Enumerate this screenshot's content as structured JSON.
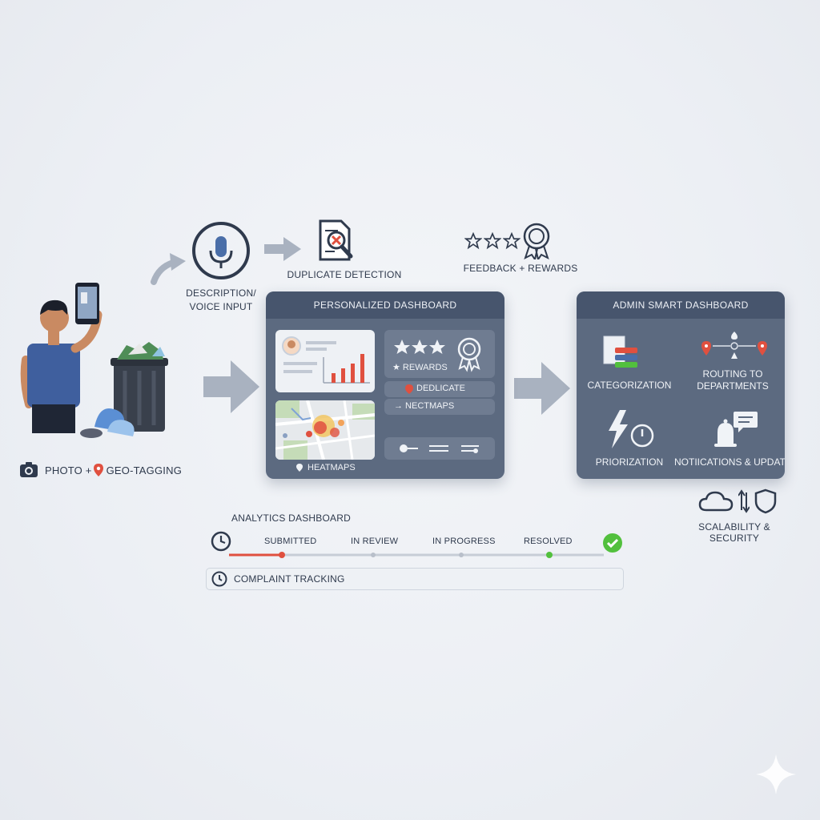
{
  "labels": {
    "description_voice": [
      "DESCRIPTION/",
      "VOICE INPUT"
    ],
    "duplicate_detection": "DUPLICATE DETECTION",
    "feedback_rewards": "FEEDBACK + REWARDS",
    "photo_geotag_prefix": "PHOTO + ",
    "photo_geotag_suffix": "GEO-TAGGING",
    "scalability_security": "SCALABILITY & SECURITY",
    "analytics_dashboard": "ANALYTICS DASHBOARD",
    "complaint_tracking": "COMPLAINT TRACKING"
  },
  "personalized_dashboard": {
    "title": "PERSONALIZED DASHBOARD",
    "rewards": "★ REWARDS",
    "dedupe": "DEDLICATE",
    "heatmaps_row": "→ NECTMAPS",
    "heatmaps_map": "HEATMAPS"
  },
  "admin_dashboard": {
    "title": "ADMIN SMART DASHBOARD",
    "categorization": "CATEGORIZATION",
    "routing": [
      "ROUTING TO",
      "DEPARTMENTS"
    ],
    "prioritization": "PRIORIZATION",
    "notifications": "NOTIICATIONS & UPDATES"
  },
  "tracking": {
    "steps": [
      "SUBMITTED",
      "IN REVIEW",
      "IN PROGRESS",
      "RESOLVED"
    ]
  },
  "icons": [
    "microphone-icon",
    "document-search-icon",
    "star-icon",
    "award-badge-icon",
    "camera-icon",
    "location-pin-icon",
    "cloud-icon",
    "sync-icon",
    "shield-icon",
    "clock-icon",
    "check-icon",
    "lightning-icon",
    "bell-icon",
    "chat-icon",
    "category-stack-icon",
    "routing-icon"
  ],
  "colors": {
    "panel": "#5c6a80",
    "panel_header": "#47556d",
    "accent_red": "#e0503f",
    "accent_green": "#52c03d",
    "arrow": "#a9b2c0"
  }
}
